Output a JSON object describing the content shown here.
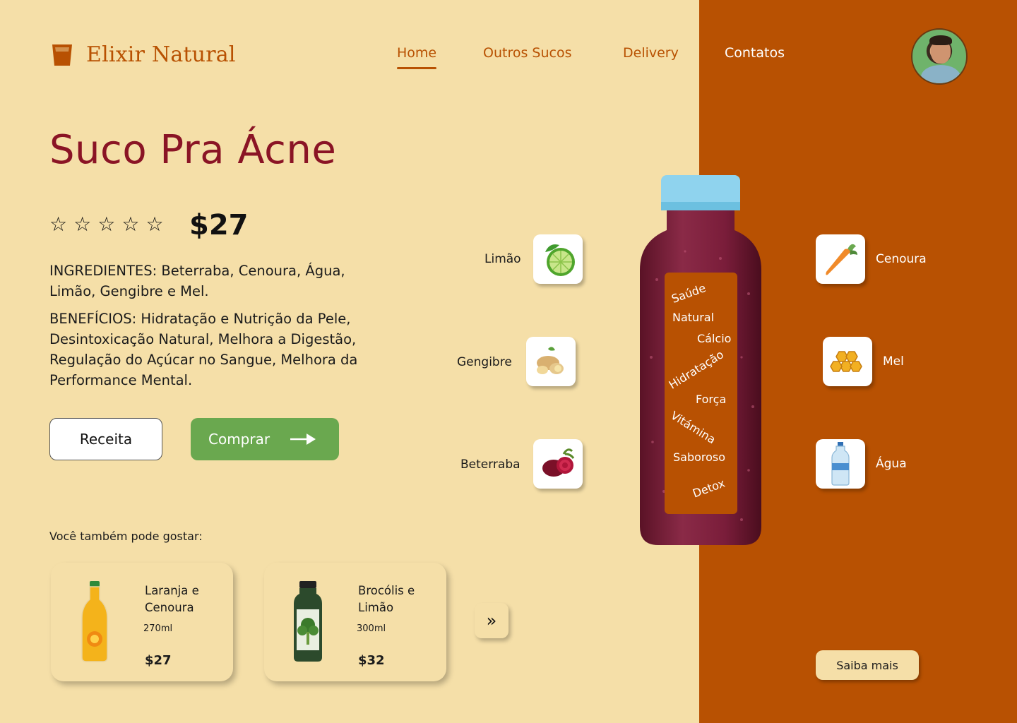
{
  "brand": {
    "name": "Elixir Natural",
    "icon": "glass-icon"
  },
  "nav": [
    {
      "label": "Home",
      "active": true
    },
    {
      "label": "Outros Sucos",
      "active": false
    },
    {
      "label": "Delivery",
      "active": false
    },
    {
      "label": "Contatos",
      "active": false
    }
  ],
  "product": {
    "title": "Suco Pra Ácne",
    "rating": 0,
    "rating_max": 5,
    "price": "$27",
    "ingredients": "INGREDIENTES: Beterraba, Cenoura, Água, Limão, Gengibre e Mel.",
    "benefits": "BENEFÍCIOS: Hidratação e Nutrição da Pele, Desintoxicação Natural, Melhora a Digestão, Regulação do Açúcar no Sangue, Melhora da Performance Mental.",
    "buttons": {
      "recipe": "Receita",
      "buy": "Comprar"
    }
  },
  "related": {
    "heading": "Você também pode gostar:",
    "items": [
      {
        "name": "Laranja e Cenoura",
        "volume": "270ml",
        "price": "$27"
      },
      {
        "name": "Brocólis e Limão",
        "volume": "300ml",
        "price": "$32"
      }
    ],
    "more_label": "»"
  },
  "ingredients_left": [
    {
      "label": "Limão",
      "icon": "lime-icon"
    },
    {
      "label": "Gengibre",
      "icon": "ginger-icon"
    },
    {
      "label": "Beterraba",
      "icon": "beet-icon"
    }
  ],
  "ingredients_right": [
    {
      "label": "Cenoura",
      "icon": "carrot-icon"
    },
    {
      "label": "Mel",
      "icon": "honey-icon"
    },
    {
      "label": "Água",
      "icon": "water-bottle-icon"
    }
  ],
  "bottle_label": [
    "Saúde",
    "Natural",
    "Cálcio",
    "Hidratação",
    "Força",
    "Vitámina",
    "Saboroso",
    "Detox"
  ],
  "cta": {
    "learn_more": "Saiba mais"
  },
  "colors": {
    "background": "#f5dfa8",
    "accent": "#b85102",
    "title": "#8a1425",
    "buy": "#6aa84f"
  }
}
